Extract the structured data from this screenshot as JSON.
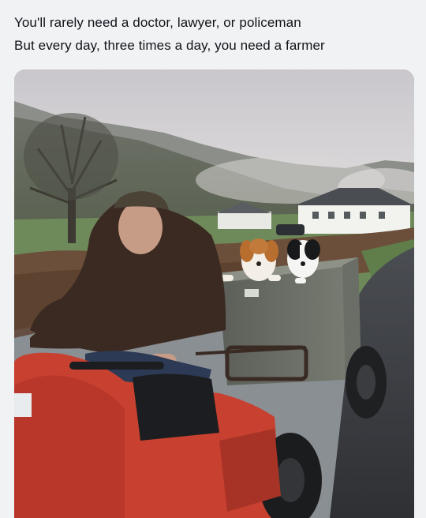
{
  "post": {
    "lines": [
      "You'll rarely need a doctor, lawyer, or policeman",
      "But every day, three times a day, you need a farmer"
    ]
  },
  "media": {
    "alt": "Photo of an elderly farmer driving a red quad bike towing a metal trailer with two dogs, on a misty countryside lane"
  },
  "colors": {
    "page_bg": "#f1f2f4",
    "text": "#0f1419",
    "quad_red": "#c8402f"
  }
}
